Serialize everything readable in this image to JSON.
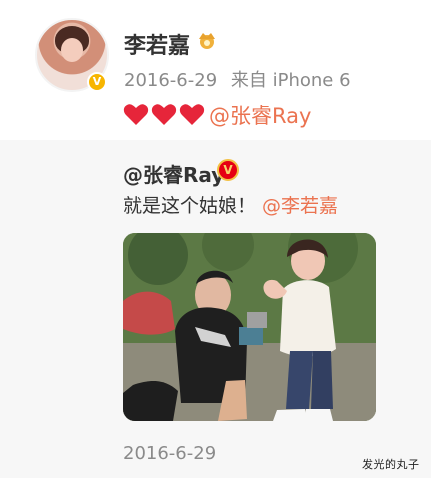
{
  "post": {
    "username": "李若嘉",
    "date": "2016-6-29",
    "source": "来自 iPhone 6",
    "verify_badge": "V",
    "content": {
      "hearts": [
        "red-heart",
        "red-heart",
        "red-heart"
      ],
      "mention": "@张睿Ray"
    }
  },
  "repost": {
    "username": "@张睿Ray",
    "badge": "V",
    "text": "就是这个姑娘！",
    "mention": "@李若嘉",
    "date": "2016-6-29"
  },
  "watermark": "发光的丸子",
  "colors": {
    "mention": "#eb7350",
    "meta": "#8a8a8a",
    "repost_bg": "#f7f7f7",
    "heart": "#e6253a"
  }
}
